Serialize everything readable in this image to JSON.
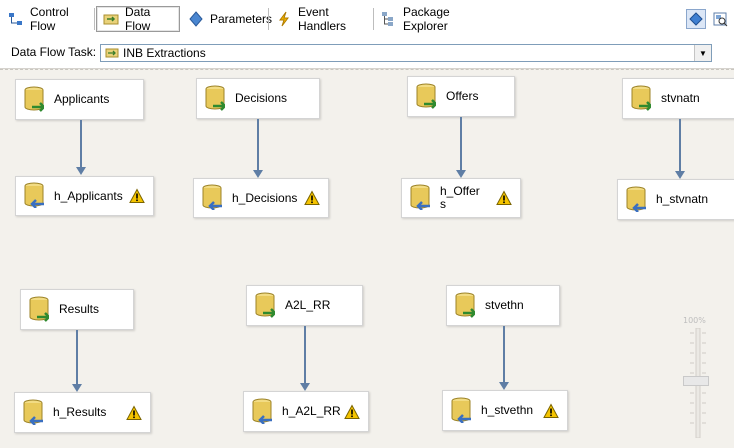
{
  "tabs": [
    {
      "label": "Control Flow",
      "icon": "control-flow-icon"
    },
    {
      "label": "Data Flow",
      "icon": "data-flow-icon"
    },
    {
      "label": "Parameters",
      "icon": "parameters-icon"
    },
    {
      "label": "Event Handlers",
      "icon": "event-handlers-icon"
    },
    {
      "label": "Package Explorer",
      "icon": "package-explorer-icon"
    }
  ],
  "task": {
    "label": "Data Flow Task:",
    "value": "INB Extractions"
  },
  "nodes": {
    "applicants": "Applicants",
    "h_applicants": "h_Applicants",
    "decisions": "Decisions",
    "h_decisions": "h_Decisions",
    "offers": "Offers",
    "h_offers_line1": "h_Offer",
    "h_offers_line2": "s",
    "stvnatn": "stvnatn",
    "h_stvnatn": "h_stvnatn",
    "results": "Results",
    "h_results": "h_Results",
    "a2l_rr": "A2L_RR",
    "h_a2l_rr": "h_A2L_RR",
    "stvethn": "stvethn",
    "h_stvethn": "h_stvethn"
  },
  "zoom": {
    "label": "100%"
  },
  "colors": {
    "connector": "#5f7ea5",
    "warning": "#f5c400",
    "db": "#e8c95a"
  }
}
